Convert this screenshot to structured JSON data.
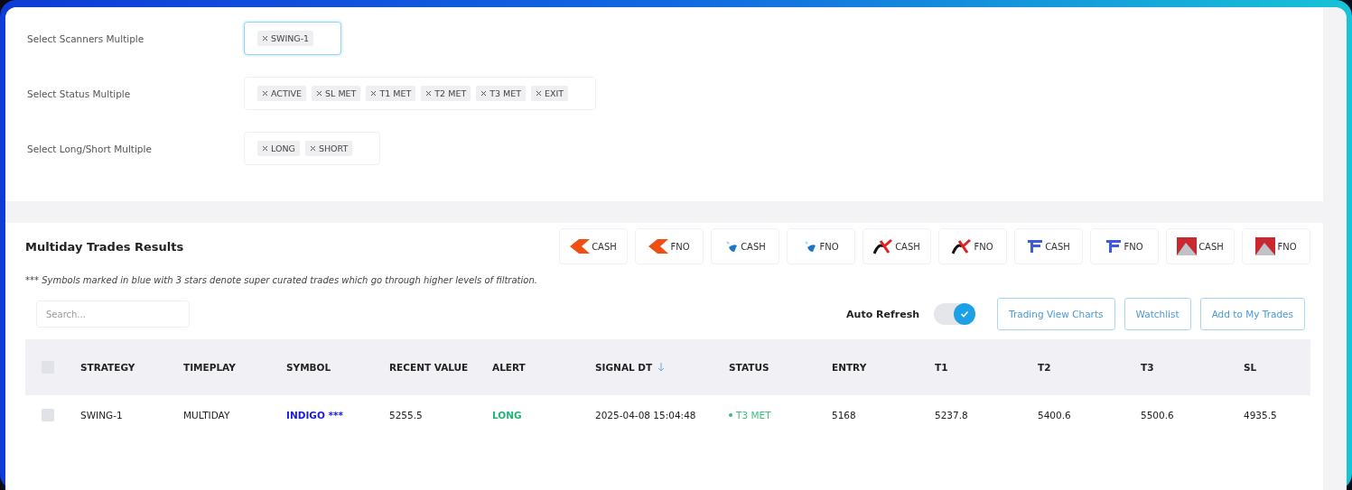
{
  "filters": [
    {
      "label": "Select Scanners Multiple",
      "focused": true,
      "chips": [
        "SWING-1"
      ]
    },
    {
      "label": "Select Status Multiple",
      "focused": false,
      "chips": [
        "ACTIVE",
        "SL MET",
        "T1 MET",
        "T2 MET",
        "T3 MET",
        "EXIT"
      ]
    },
    {
      "label": "Select Long/Short Multiple",
      "focused": false,
      "chips": [
        "LONG",
        "SHORT"
      ]
    }
  ],
  "results": {
    "title": "Multiday Trades Results",
    "brokers": [
      {
        "kind": "chevron",
        "label": "CASH"
      },
      {
        "kind": "chevron",
        "label": "FNO"
      },
      {
        "kind": "drop",
        "label": "CASH"
      },
      {
        "kind": "drop",
        "label": "FNO"
      },
      {
        "kind": "cross",
        "label": "CASH"
      },
      {
        "kind": "cross",
        "label": "FNO"
      },
      {
        "kind": "letterf",
        "label": "CASH"
      },
      {
        "kind": "letterf",
        "label": "FNO"
      },
      {
        "kind": "tile",
        "label": "CASH"
      },
      {
        "kind": "tile",
        "label": "FNO"
      }
    ],
    "note": "*** Symbols marked in blue with 3 stars denote super curated trades which go through higher levels of filtration.",
    "search": {
      "placeholder": "Search..."
    },
    "auto_refresh": {
      "label": "Auto Refresh",
      "on": true
    },
    "buttons": [
      "Trading View Charts",
      "Watchlist",
      "Add to My Trades"
    ],
    "table": {
      "select_all": {
        "checked": false
      },
      "columns": [
        {
          "label": "STRATEGY",
          "sorted": false
        },
        {
          "label": "TIMEPLAY",
          "sorted": false
        },
        {
          "label": "SYMBOL",
          "sorted": false
        },
        {
          "label": "RECENT VALUE",
          "sorted": false
        },
        {
          "label": "ALERT",
          "sorted": false
        },
        {
          "label": "SIGNAL DT",
          "sorted": true
        },
        {
          "label": "STATUS",
          "sorted": false
        },
        {
          "label": "ENTRY",
          "sorted": false
        },
        {
          "label": "T1",
          "sorted": false
        },
        {
          "label": "T2",
          "sorted": false
        },
        {
          "label": "T3",
          "sorted": false
        },
        {
          "label": "SL",
          "sorted": false
        }
      ],
      "rows": [
        {
          "checked": false,
          "strategy": "SWING-1",
          "timeplay": "MULTIDAY",
          "symbol": "INDIGO ***",
          "curated": true,
          "recent_value": "5255.5",
          "alert": {
            "text": "LONG",
            "color": "#22b573"
          },
          "signal_dt": "2025-04-08 15:04:48",
          "status": {
            "text": "T3 MET",
            "color": "#3cbf7d"
          },
          "entry": "5168",
          "t1": "5237.8",
          "t2": "5400.6",
          "t3": "5500.6",
          "sl": "4935.5"
        }
      ]
    }
  }
}
